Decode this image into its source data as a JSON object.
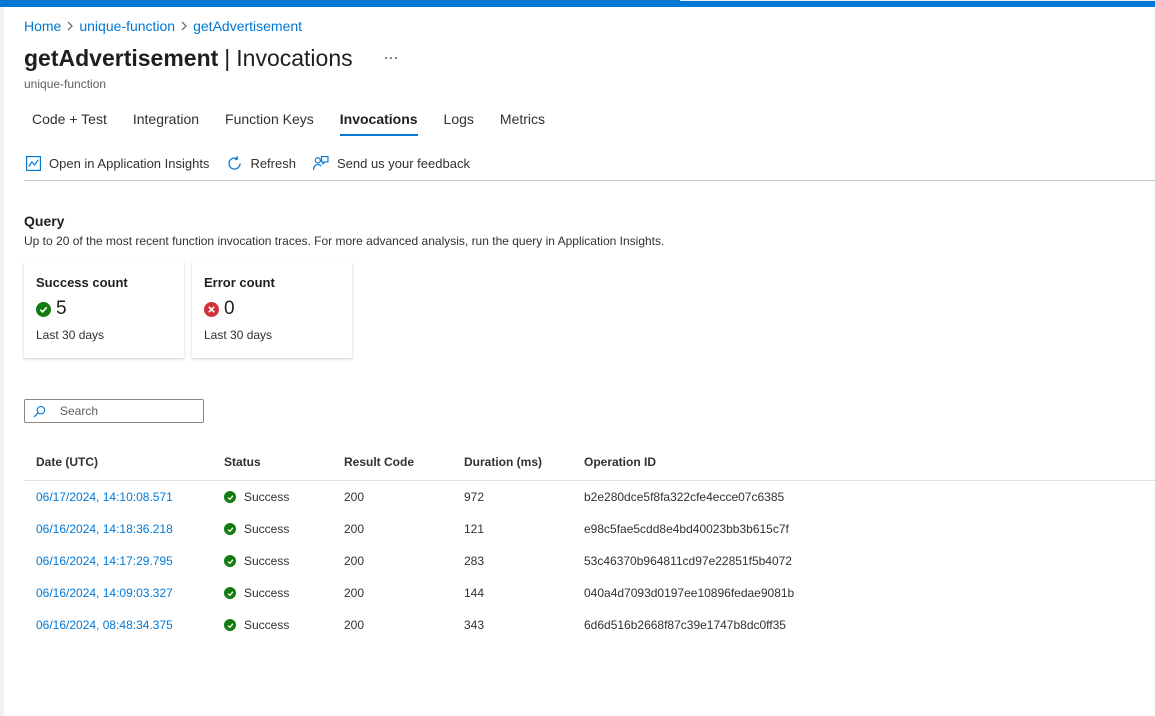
{
  "colors": {
    "accent": "#0078d4",
    "success": "#107c10",
    "error": "#d13438"
  },
  "breadcrumb": {
    "items": [
      "Home",
      "unique-function",
      "getAdvertisement"
    ]
  },
  "header": {
    "title": "getAdvertisement",
    "separator": "|",
    "section": "Invocations",
    "subtitle": "unique-function",
    "more_icon": "ellipsis-icon"
  },
  "tabs": [
    {
      "label": "Code + Test",
      "active": false
    },
    {
      "label": "Integration",
      "active": false
    },
    {
      "label": "Function Keys",
      "active": false
    },
    {
      "label": "Invocations",
      "active": true
    },
    {
      "label": "Logs",
      "active": false
    },
    {
      "label": "Metrics",
      "active": false
    }
  ],
  "toolbar": {
    "open_insights_label": "Open in Application Insights",
    "open_insights_icon": "chart-icon",
    "refresh_label": "Refresh",
    "refresh_icon": "refresh-icon",
    "feedback_label": "Send us your feedback",
    "feedback_icon": "feedback-icon"
  },
  "query": {
    "title": "Query",
    "description": "Up to 20 of the most recent function invocation traces. For more advanced analysis, run the query in Application Insights."
  },
  "cards": {
    "success": {
      "title": "Success count",
      "value": "5",
      "footer": "Last 30 days",
      "icon": "success-check-icon"
    },
    "error": {
      "title": "Error count",
      "value": "0",
      "footer": "Last 30 days",
      "icon": "error-x-icon"
    }
  },
  "search": {
    "placeholder": "Search",
    "value": ""
  },
  "table": {
    "headers": {
      "date": "Date (UTC)",
      "status": "Status",
      "result": "Result Code",
      "duration": "Duration (ms)",
      "operation": "Operation ID"
    },
    "rows": [
      {
        "date": "06/17/2024, 14:10:08.571",
        "status": "Success",
        "result": "200",
        "duration": "972",
        "operation": "b2e280dce5f8fa322cfe4ecce07c6385"
      },
      {
        "date": "06/16/2024, 14:18:36.218",
        "status": "Success",
        "result": "200",
        "duration": "121",
        "operation": "e98c5fae5cdd8e4bd40023bb3b615c7f"
      },
      {
        "date": "06/16/2024, 14:17:29.795",
        "status": "Success",
        "result": "200",
        "duration": "283",
        "operation": "53c46370b964811cd97e22851f5b4072"
      },
      {
        "date": "06/16/2024, 14:09:03.327",
        "status": "Success",
        "result": "200",
        "duration": "144",
        "operation": "040a4d7093d0197ee10896fedae9081b"
      },
      {
        "date": "06/16/2024, 08:48:34.375",
        "status": "Success",
        "result": "200",
        "duration": "343",
        "operation": "6d6d516b2668f87c39e1747b8dc0ff35"
      }
    ]
  }
}
